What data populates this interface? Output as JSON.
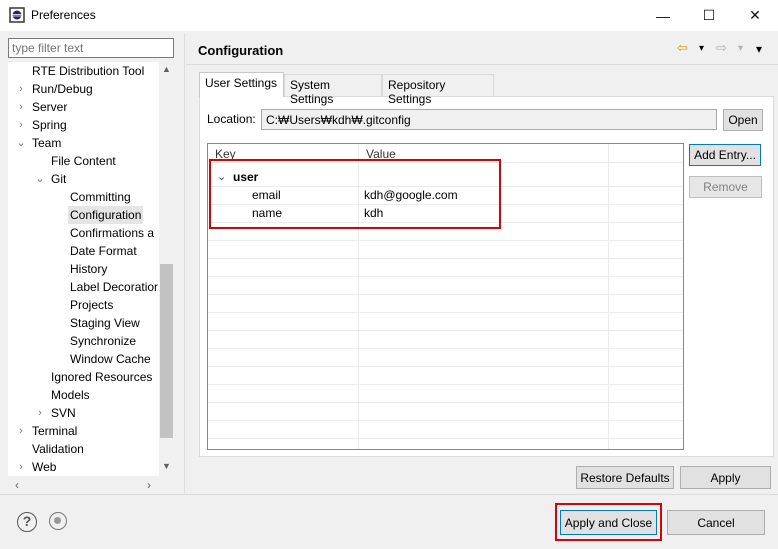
{
  "window": {
    "title": "Preferences",
    "minimize_glyph": "—",
    "maximize_glyph": "☐",
    "close_glyph": "✕"
  },
  "sidebar": {
    "filter_placeholder": "type filter text",
    "items": [
      {
        "label": "RTE Distribution Tool",
        "chevron": "",
        "selected": false
      },
      {
        "label": "Run/Debug",
        "chevron": "›",
        "selected": false
      },
      {
        "label": "Server",
        "chevron": "›",
        "selected": false
      },
      {
        "label": "Spring",
        "chevron": "›",
        "selected": false
      },
      {
        "label": "Team",
        "chevron": "⌄",
        "selected": false
      },
      {
        "label": "File Content",
        "chevron": "",
        "selected": false
      },
      {
        "label": "Git",
        "chevron": "⌄",
        "selected": false
      },
      {
        "label": "Committing",
        "chevron": "",
        "selected": false
      },
      {
        "label": "Configuration",
        "chevron": "",
        "selected": true
      },
      {
        "label": "Confirmations a",
        "chevron": "",
        "selected": false
      },
      {
        "label": "Date Format",
        "chevron": "",
        "selected": false
      },
      {
        "label": "History",
        "chevron": "",
        "selected": false
      },
      {
        "label": "Label Decoratior",
        "chevron": "",
        "selected": false
      },
      {
        "label": "Projects",
        "chevron": "",
        "selected": false
      },
      {
        "label": "Staging View",
        "chevron": "",
        "selected": false
      },
      {
        "label": "Synchronize",
        "chevron": "",
        "selected": false
      },
      {
        "label": "Window Cache",
        "chevron": "",
        "selected": false
      },
      {
        "label": "Ignored Resources",
        "chevron": "",
        "selected": false
      },
      {
        "label": "Models",
        "chevron": "",
        "selected": false
      },
      {
        "label": "SVN",
        "chevron": "›",
        "selected": false
      },
      {
        "label": "Terminal",
        "chevron": "›",
        "selected": false
      },
      {
        "label": "Validation",
        "chevron": "",
        "selected": false
      },
      {
        "label": "Web",
        "chevron": "›",
        "selected": false
      }
    ]
  },
  "page": {
    "title": "Configuration",
    "nav": {
      "back": "⇦",
      "forward": "⇨",
      "dropdown": "▾",
      "menu": "▾"
    }
  },
  "tabs": [
    {
      "label": "User Settings",
      "active": true
    },
    {
      "label": "System Settings",
      "active": false
    },
    {
      "label": "Repository Settings",
      "active": false
    }
  ],
  "location": {
    "label": "Location:",
    "value": "C:₩Users₩kdh₩.gitconfig",
    "open_button": "Open"
  },
  "table": {
    "headers": {
      "key": "Key",
      "value": "Value"
    },
    "section": {
      "label": "user",
      "chevron": "⌄"
    },
    "rows": [
      {
        "key": "email",
        "value": "kdh@google.com"
      },
      {
        "key": "name",
        "value": "kdh"
      }
    ]
  },
  "side_buttons": {
    "add_entry": "Add Entry...",
    "remove": "Remove"
  },
  "page_buttons": {
    "restore_defaults": "Restore Defaults",
    "apply": "Apply"
  },
  "dialog_buttons": {
    "apply_and_close": "Apply and Close",
    "cancel": "Cancel",
    "help": "?"
  },
  "scroll": {
    "up": "▲",
    "down": "▼",
    "left": "‹",
    "right": "›"
  },
  "colors": {
    "highlight": "#e00000",
    "focus": "#0078d7"
  }
}
